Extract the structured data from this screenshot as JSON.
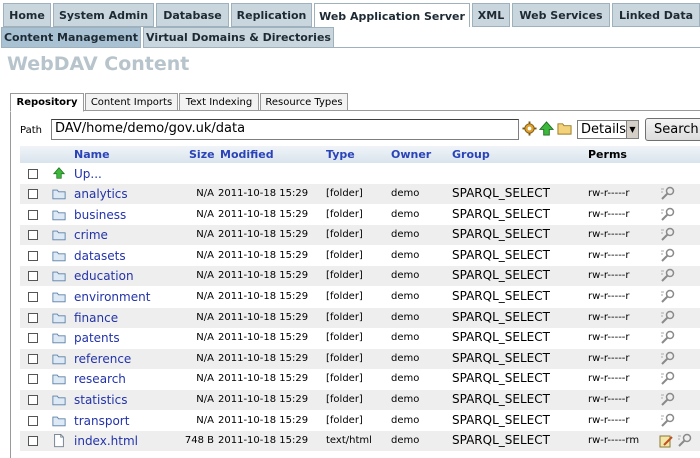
{
  "top_tabs": [
    {
      "label": "Home",
      "active": false
    },
    {
      "label": "System Admin",
      "active": false
    },
    {
      "label": "Database",
      "active": false
    },
    {
      "label": "Replication",
      "active": false
    },
    {
      "label": "Web Application Server",
      "active": true
    },
    {
      "label": "XML",
      "active": false
    },
    {
      "label": "Web Services",
      "active": false
    },
    {
      "label": "Linked Data",
      "active": false
    }
  ],
  "sub_tabs": [
    {
      "label": "Content Management",
      "active": true
    },
    {
      "label": "Virtual Domains & Directories",
      "active": false
    }
  ],
  "page_title": "WebDAV Content",
  "inner_tabs": [
    {
      "label": "Repository",
      "active": true
    },
    {
      "label": "Content Imports",
      "active": false
    },
    {
      "label": "Text Indexing",
      "active": false
    },
    {
      "label": "Resource Types",
      "active": false
    }
  ],
  "path": {
    "label": "Path",
    "value": "DAV/home/demo/gov.uk/data"
  },
  "view_select": {
    "value": "Details"
  },
  "search_button": "Search",
  "columns": {
    "name": "Name",
    "size": "Size",
    "modified": "Modified",
    "type": "Type",
    "owner": "Owner",
    "group": "Group",
    "perms": "Perms"
  },
  "up_link": "Up...",
  "rows": [
    {
      "name": "analytics",
      "size": "N/A",
      "modified": "2011-10-18 15:29",
      "type": "[folder]",
      "owner": "demo",
      "group": "SPARQL_SELECT",
      "perms": "rw-r-----r"
    },
    {
      "name": "business",
      "size": "N/A",
      "modified": "2011-10-18 15:29",
      "type": "[folder]",
      "owner": "demo",
      "group": "SPARQL_SELECT",
      "perms": "rw-r-----r"
    },
    {
      "name": "crime",
      "size": "N/A",
      "modified": "2011-10-18 15:29",
      "type": "[folder]",
      "owner": "demo",
      "group": "SPARQL_SELECT",
      "perms": "rw-r-----r"
    },
    {
      "name": "datasets",
      "size": "N/A",
      "modified": "2011-10-18 15:29",
      "type": "[folder]",
      "owner": "demo",
      "group": "SPARQL_SELECT",
      "perms": "rw-r-----r"
    },
    {
      "name": "education",
      "size": "N/A",
      "modified": "2011-10-18 15:29",
      "type": "[folder]",
      "owner": "demo",
      "group": "SPARQL_SELECT",
      "perms": "rw-r-----r"
    },
    {
      "name": "environment",
      "size": "N/A",
      "modified": "2011-10-18 15:29",
      "type": "[folder]",
      "owner": "demo",
      "group": "SPARQL_SELECT",
      "perms": "rw-r-----r"
    },
    {
      "name": "finance",
      "size": "N/A",
      "modified": "2011-10-18 15:29",
      "type": "[folder]",
      "owner": "demo",
      "group": "SPARQL_SELECT",
      "perms": "rw-r-----r"
    },
    {
      "name": "patents",
      "size": "N/A",
      "modified": "2011-10-18 15:29",
      "type": "[folder]",
      "owner": "demo",
      "group": "SPARQL_SELECT",
      "perms": "rw-r-----r"
    },
    {
      "name": "reference",
      "size": "N/A",
      "modified": "2011-10-18 15:29",
      "type": "[folder]",
      "owner": "demo",
      "group": "SPARQL_SELECT",
      "perms": "rw-r-----r"
    },
    {
      "name": "research",
      "size": "N/A",
      "modified": "2011-10-18 15:29",
      "type": "[folder]",
      "owner": "demo",
      "group": "SPARQL_SELECT",
      "perms": "rw-r-----r"
    },
    {
      "name": "statistics",
      "size": "N/A",
      "modified": "2011-10-18 15:29",
      "type": "[folder]",
      "owner": "demo",
      "group": "SPARQL_SELECT",
      "perms": "rw-r-----r"
    },
    {
      "name": "transport",
      "size": "N/A",
      "modified": "2011-10-18 15:29",
      "type": "[folder]",
      "owner": "demo",
      "group": "SPARQL_SELECT",
      "perms": "rw-r-----r"
    },
    {
      "name": "index.html",
      "size": "748 B",
      "modified": "2011-10-18 15:29",
      "type": "text/html",
      "owner": "demo",
      "group": "SPARQL_SELECT",
      "perms": "rw-r-----rm",
      "file": true
    }
  ],
  "colors": {
    "accent_link": "#2233aa",
    "tab_bg": "#c9d6de",
    "title": "#b7c4cc"
  }
}
